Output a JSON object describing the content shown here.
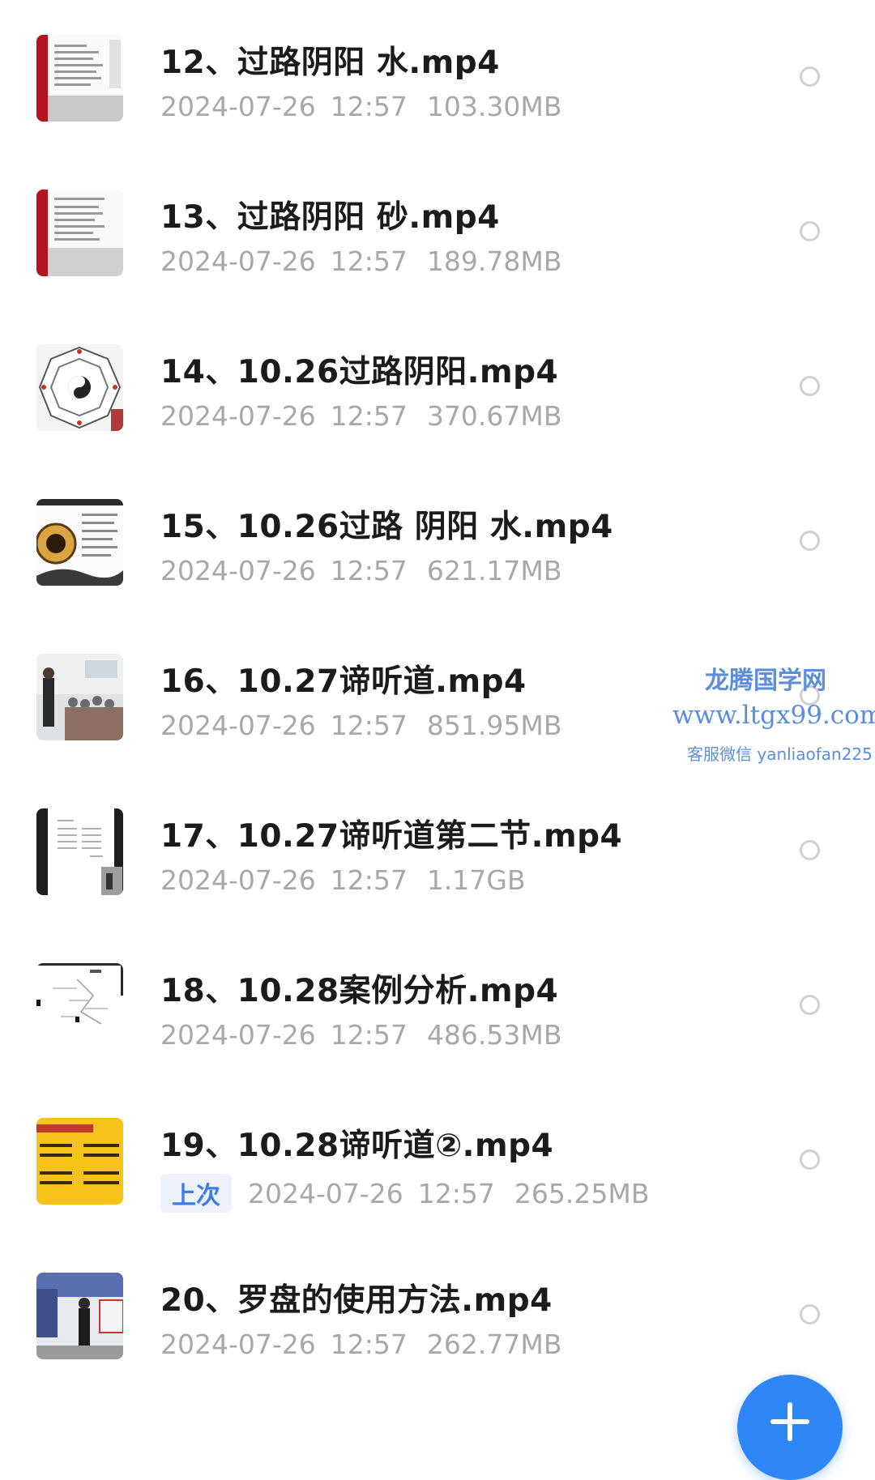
{
  "files": [
    {
      "name": "12、过路阴阳 水.mp4",
      "date": "2024-07-26",
      "time": "12:57",
      "size": "103.30MB",
      "badge": "",
      "thumb": "doc-red-icon"
    },
    {
      "name": "13、过路阴阳 砂.mp4",
      "date": "2024-07-26",
      "time": "12:57",
      "size": "189.78MB",
      "badge": "",
      "thumb": "doc-red-icon"
    },
    {
      "name": "14、10.26过路阴阳.mp4",
      "date": "2024-07-26",
      "time": "12:57",
      "size": "370.67MB",
      "badge": "",
      "thumb": "bagua-icon"
    },
    {
      "name": "15、10.26过路 阴阳 水.mp4",
      "date": "2024-07-26",
      "time": "12:57",
      "size": "621.17MB",
      "badge": "",
      "thumb": "compass-slide-icon"
    },
    {
      "name": "16、10.27谛听道.mp4",
      "date": "2024-07-26",
      "time": "12:57",
      "size": "851.95MB",
      "badge": "",
      "thumb": "classroom-icon"
    },
    {
      "name": "17、10.27谛听道第二节.mp4",
      "date": "2024-07-26",
      "time": "12:57",
      "size": "1.17GB",
      "badge": "",
      "thumb": "slide-dark-icon"
    },
    {
      "name": "18、10.28案例分析.mp4",
      "date": "2024-07-26",
      "time": "12:57",
      "size": "486.53MB",
      "badge": "",
      "thumb": "sketch-icon"
    },
    {
      "name": "19、10.28谛听道②.mp4",
      "date": "2024-07-26",
      "time": "12:57",
      "size": "265.25MB",
      "badge": "上次",
      "thumb": "yellow-slide-icon"
    },
    {
      "name": "20、罗盘的使用方法.mp4",
      "date": "2024-07-26",
      "time": "12:57",
      "size": "262.77MB",
      "badge": "",
      "thumb": "presenter-icon"
    }
  ],
  "watermark": {
    "title": "龙腾国学网",
    "url": "www.ltgx99.com",
    "contact": "客服微信 yanliaofan225"
  },
  "colors": {
    "accent": "#2f86f6",
    "meta": "#a8a8a8",
    "badge": "#3d7be8"
  }
}
